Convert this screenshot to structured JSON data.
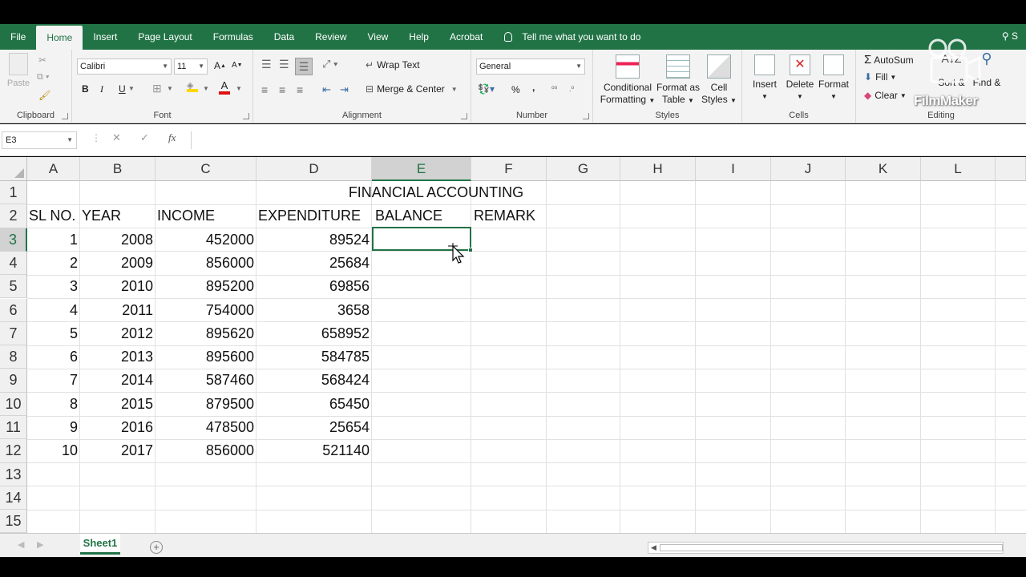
{
  "ribbon_tabs": [
    "File",
    "Home",
    "Insert",
    "Page Layout",
    "Formulas",
    "Data",
    "Review",
    "View",
    "Help",
    "Acrobat"
  ],
  "active_tab": "Home",
  "tell_me": "Tell me what you want to do",
  "share_label": "S",
  "clipboard": {
    "paste": "Paste",
    "label": "Clipboard"
  },
  "font": {
    "name": "Calibri",
    "size": "11",
    "label": "Font",
    "bold": "B",
    "italic": "I",
    "underline": "U",
    "grow": "A",
    "shrink": "A"
  },
  "alignment": {
    "wrap_text": "Wrap Text",
    "merge_center": "Merge & Center",
    "label": "Alignment"
  },
  "number": {
    "format": "General",
    "percent": "%",
    "comma": ",",
    "label": "Number"
  },
  "styles": {
    "conditional": "Conditional",
    "formatting": "Formatting",
    "format_as": "Format as",
    "table": "Table",
    "cell": "Cell",
    "cell_styles": "Styles",
    "label": "Styles"
  },
  "cells": {
    "insert": "Insert",
    "delete": "Delete",
    "format": "Format",
    "label": "Cells"
  },
  "editing": {
    "autosum": "AutoSum",
    "fill": "Fill",
    "clear": "Clear",
    "sort": "Sort &",
    "find": "Find &",
    "label": "Editing"
  },
  "formula_bar": {
    "name_box": "E3",
    "cancel": "✕",
    "enter": "✓",
    "fx": "fx",
    "formula": ""
  },
  "columns": [
    "A",
    "B",
    "C",
    "D",
    "E",
    "F",
    "G",
    "H",
    "I",
    "J",
    "K",
    "L"
  ],
  "selected_column": "E",
  "rows": [
    "1",
    "2",
    "3",
    "4",
    "5",
    "6",
    "7",
    "8",
    "9",
    "10",
    "11",
    "12",
    "13",
    "14",
    "15"
  ],
  "selected_row": "3",
  "sheet": {
    "title": "FINANCIAL ACCOUNTING",
    "headers": [
      "SL NO.",
      "YEAR",
      "INCOME",
      "EXPENDITURE",
      "BALANCE",
      "REMARK"
    ],
    "data": [
      [
        "1",
        "2008",
        "452000",
        "89524"
      ],
      [
        "2",
        "2009",
        "856000",
        "25684"
      ],
      [
        "3",
        "2010",
        "895200",
        "69856"
      ],
      [
        "4",
        "2011",
        "754000",
        "3658"
      ],
      [
        "5",
        "2012",
        "895620",
        "658952"
      ],
      [
        "6",
        "2013",
        "895600",
        "584785"
      ],
      [
        "7",
        "2014",
        "587460",
        "568424"
      ],
      [
        "8",
        "2015",
        "879500",
        "65450"
      ],
      [
        "9",
        "2016",
        "478500",
        "25654"
      ],
      [
        "10",
        "2017",
        "856000",
        "521140"
      ]
    ]
  },
  "sheet_tabs": [
    "Sheet1"
  ],
  "add_sheet": "+",
  "watermark": "FilmMaker",
  "accent_color": "#217346"
}
